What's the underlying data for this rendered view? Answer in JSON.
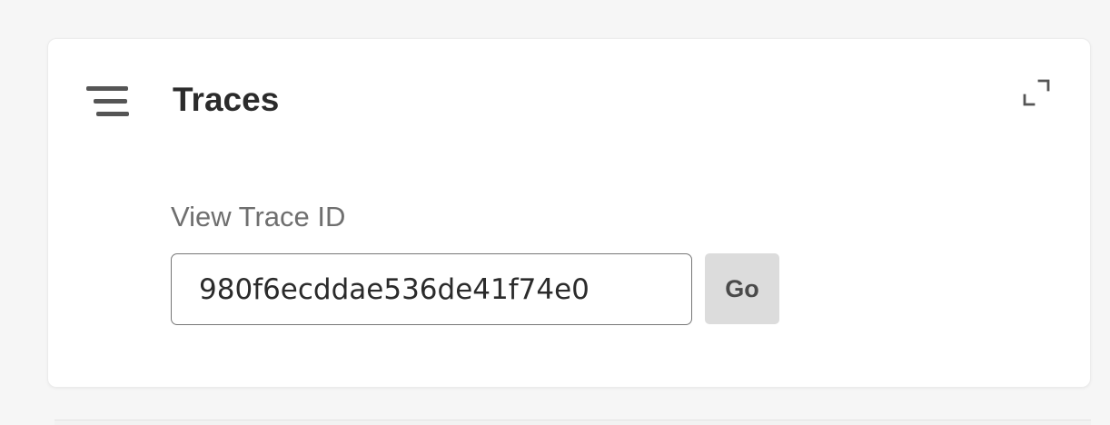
{
  "panel": {
    "title": "Traces",
    "icons": {
      "panel_icon": "traces-icon",
      "expand_icon": "expand-icon"
    }
  },
  "trace_search": {
    "label": "View Trace ID",
    "input_value": "980f6ecddae536de41f74e0",
    "go_label": "Go"
  },
  "colors": {
    "background": "#f6f6f6",
    "card": "#ffffff",
    "title": "#2b2b2b",
    "label": "#6f6f6f",
    "button_bg": "#dcdcdc",
    "icon": "#555555"
  }
}
